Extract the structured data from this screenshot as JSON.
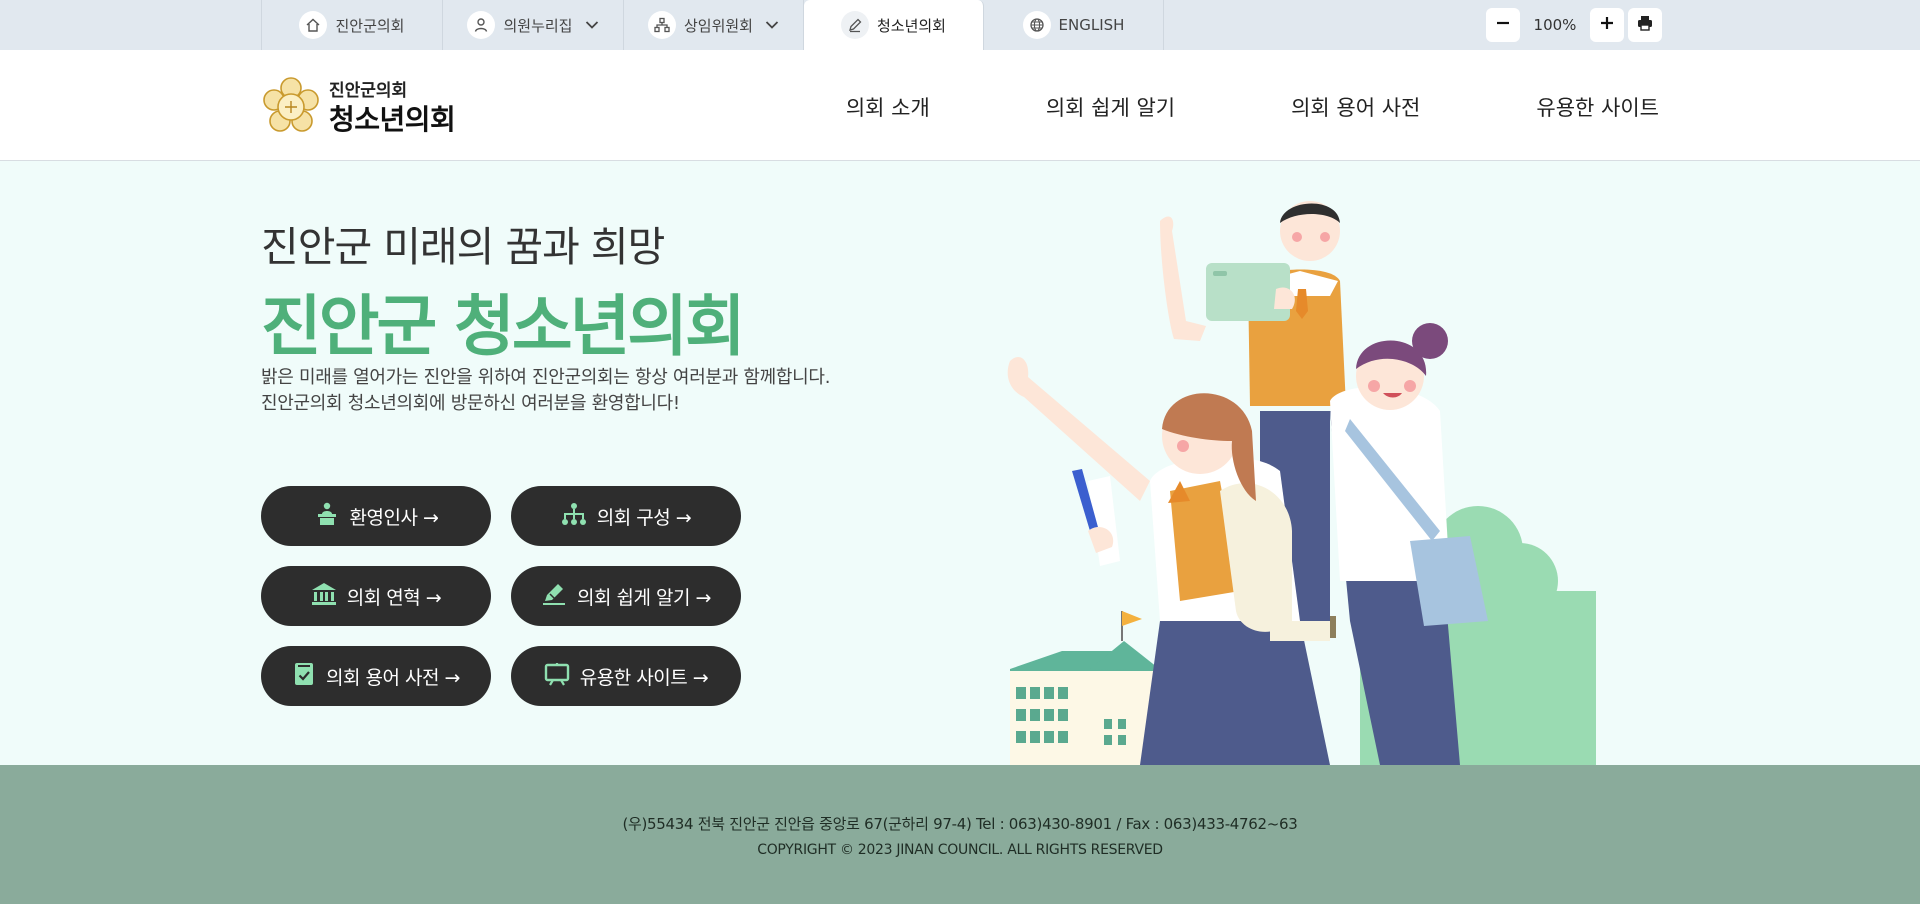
{
  "topbar": {
    "tabs": [
      {
        "label": "진안군의회",
        "icon": "home-icon",
        "has_dropdown": false,
        "active": false
      },
      {
        "label": "의원누리집",
        "icon": "person-icon",
        "has_dropdown": true,
        "active": false
      },
      {
        "label": "상임위원회",
        "icon": "org-icon",
        "has_dropdown": true,
        "active": false
      },
      {
        "label": "청소년의회",
        "icon": "pen-icon",
        "has_dropdown": false,
        "active": true
      },
      {
        "label": "ENGLISH",
        "icon": "globe-icon",
        "has_dropdown": false,
        "active": false
      }
    ],
    "zoom": "100%"
  },
  "header": {
    "logo_small": "진안군의회",
    "logo_big": "청소년의회",
    "nav": [
      "의회 소개",
      "의회 쉽게 알기",
      "의회 용어 사전",
      "유용한 사이트"
    ]
  },
  "hero": {
    "subtitle": "진안군 미래의 꿈과 희망",
    "title": "진안군 청소년의회",
    "desc_line1": "밝은 미래를 열어가는 진안을 위하여 진안군의회는 항상 여러분과 함께합니다.",
    "desc_line2": "진안군의회 청소년의회에 방문하신 여러분을 환영합니다!",
    "buttons": [
      {
        "label": "환영인사 →",
        "icon": "speaker-podium-icon"
      },
      {
        "label": "의회 구성 →",
        "icon": "org-chart-icon"
      },
      {
        "label": "의회 연혁 →",
        "icon": "building-icon"
      },
      {
        "label": "의회 쉽게 알기 →",
        "icon": "pen-write-icon"
      },
      {
        "label": "의회 용어 사전 →",
        "icon": "book-check-icon"
      },
      {
        "label": "유용한 사이트 →",
        "icon": "monitor-icon"
      }
    ]
  },
  "footer": {
    "address": "(우)55434 전북 진안군 진안읍 중앙로 67(군하리 97-4) Tel : 063)430-8901 / Fax : 063)433-4762~63",
    "copyright": "COPYRIGHT © 2023 JINAN COUNCIL. ALL RIGHTS RESERVED"
  },
  "colors": {
    "accent_green": "#4fb07a",
    "icon_green": "#8fe0b0",
    "button_dark": "#2d2d2d",
    "hero_bg": "#f0fcfa",
    "footer_bg": "#8aab9b",
    "topbar_bg": "#e1e8ef"
  }
}
